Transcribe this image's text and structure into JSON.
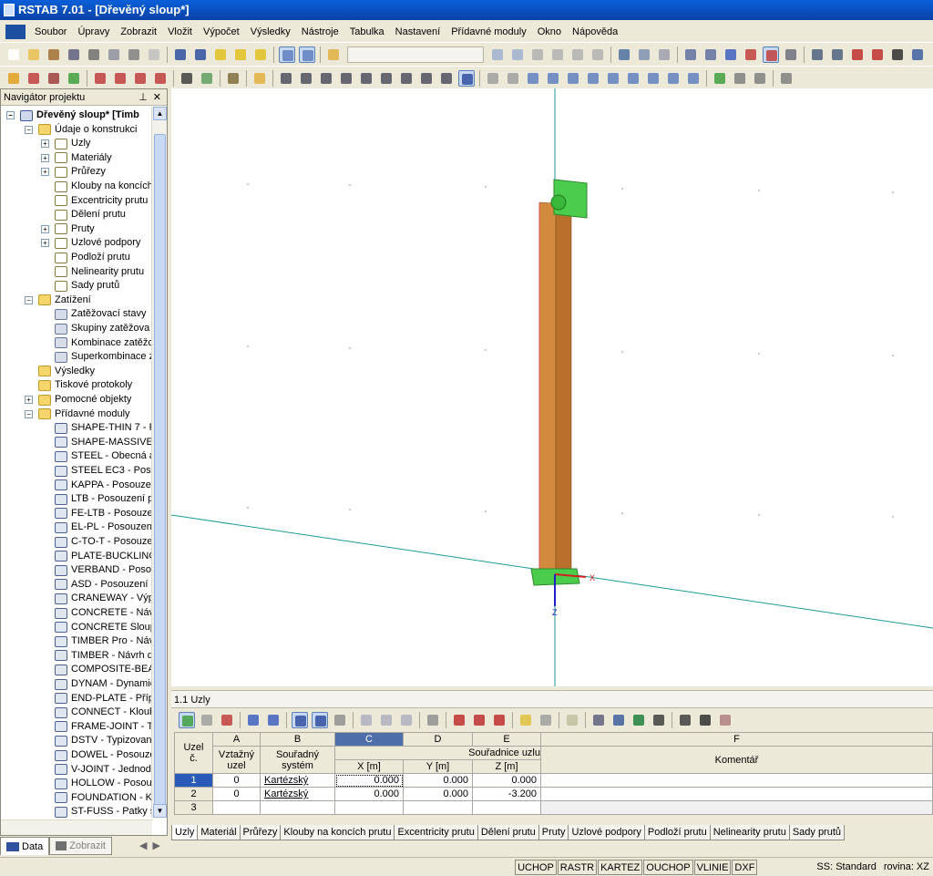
{
  "window": {
    "title": "RSTAB 7.01 - [Dřevěný sloup*]"
  },
  "menu": [
    "Soubor",
    "Úpravy",
    "Zobrazit",
    "Vložit",
    "Výpočet",
    "Výsledky",
    "Nástroje",
    "Tabulka",
    "Nastavení",
    "Přídavné moduly",
    "Okno",
    "Nápověda"
  ],
  "navigator": {
    "title": "Navigátor projektu",
    "tree": [
      {
        "label": "Dřevěný sloup* [Timb",
        "level": 0,
        "exp": "-",
        "icon": "proj",
        "bold": true
      },
      {
        "label": "Údaje o konstrukci",
        "level": 1,
        "exp": "-",
        "icon": "folder"
      },
      {
        "label": "Uzly",
        "level": 2,
        "exp": "+",
        "icon": "node"
      },
      {
        "label": "Materiály",
        "level": 2,
        "exp": "+",
        "icon": "node"
      },
      {
        "label": "Průřezy",
        "level": 2,
        "exp": "+",
        "icon": "node"
      },
      {
        "label": "Klouby na koncích",
        "level": 2,
        "exp": "",
        "icon": "node"
      },
      {
        "label": "Excentricity prutu",
        "level": 2,
        "exp": "",
        "icon": "node"
      },
      {
        "label": "Dělení prutu",
        "level": 2,
        "exp": "",
        "icon": "node"
      },
      {
        "label": "Pruty",
        "level": 2,
        "exp": "+",
        "icon": "node"
      },
      {
        "label": "Uzlové podpory",
        "level": 2,
        "exp": "+",
        "icon": "node"
      },
      {
        "label": "Podloží prutu",
        "level": 2,
        "exp": "",
        "icon": "node"
      },
      {
        "label": "Nelinearity prutu",
        "level": 2,
        "exp": "",
        "icon": "node"
      },
      {
        "label": "Sady prutů",
        "level": 2,
        "exp": "",
        "icon": "node"
      },
      {
        "label": "Zatížení",
        "level": 1,
        "exp": "-",
        "icon": "folder"
      },
      {
        "label": "Zatěžovací stavy",
        "level": 2,
        "exp": "",
        "icon": "load"
      },
      {
        "label": "Skupiny zatěžova",
        "level": 2,
        "exp": "",
        "icon": "load"
      },
      {
        "label": "Kombinace zatěžc",
        "level": 2,
        "exp": "",
        "icon": "load"
      },
      {
        "label": "Superkombinace z",
        "level": 2,
        "exp": "",
        "icon": "load"
      },
      {
        "label": "Výsledky",
        "level": 1,
        "exp": "",
        "icon": "folder"
      },
      {
        "label": "Tiskové protokoly",
        "level": 1,
        "exp": "",
        "icon": "folder"
      },
      {
        "label": "Pomocné objekty",
        "level": 1,
        "exp": "+",
        "icon": "folder"
      },
      {
        "label": "Přídavné moduly",
        "level": 1,
        "exp": "-",
        "icon": "folder"
      },
      {
        "label": "SHAPE-THIN 7 - P",
        "level": 2,
        "exp": "",
        "icon": "mod"
      },
      {
        "label": "SHAPE-MASSIVE -",
        "level": 2,
        "exp": "",
        "icon": "mod"
      },
      {
        "label": "STEEL - Obecná a",
        "level": 2,
        "exp": "",
        "icon": "mod"
      },
      {
        "label": "STEEL EC3 - Posu",
        "level": 2,
        "exp": "",
        "icon": "mod"
      },
      {
        "label": "KAPPA - Posouzer",
        "level": 2,
        "exp": "",
        "icon": "mod"
      },
      {
        "label": "LTB - Posouzení p",
        "level": 2,
        "exp": "",
        "icon": "mod"
      },
      {
        "label": "FE-LTB - Posouze",
        "level": 2,
        "exp": "",
        "icon": "mod"
      },
      {
        "label": "EL-PL - Posouzení",
        "level": 2,
        "exp": "",
        "icon": "mod"
      },
      {
        "label": "C-TO-T - Posouze",
        "level": 2,
        "exp": "",
        "icon": "mod"
      },
      {
        "label": "PLATE-BUCKLING",
        "level": 2,
        "exp": "",
        "icon": "mod"
      },
      {
        "label": "VERBAND - Posou",
        "level": 2,
        "exp": "",
        "icon": "mod"
      },
      {
        "label": "ASD - Posouzení c",
        "level": 2,
        "exp": "",
        "icon": "mod"
      },
      {
        "label": "CRANEWAY - Výp",
        "level": 2,
        "exp": "",
        "icon": "mod"
      },
      {
        "label": "CONCRETE - Návr",
        "level": 2,
        "exp": "",
        "icon": "mod"
      },
      {
        "label": "CONCRETE Sloupy",
        "level": 2,
        "exp": "",
        "icon": "mod"
      },
      {
        "label": "TIMBER Pro - Náv",
        "level": 2,
        "exp": "",
        "icon": "mod"
      },
      {
        "label": "TIMBER - Návrh d",
        "level": 2,
        "exp": "",
        "icon": "mod"
      },
      {
        "label": "COMPOSITE-BEAN",
        "level": 2,
        "exp": "",
        "icon": "mod"
      },
      {
        "label": "DYNAM - Dynamic",
        "level": 2,
        "exp": "",
        "icon": "mod"
      },
      {
        "label": "END-PLATE - Přípc",
        "level": 2,
        "exp": "",
        "icon": "mod"
      },
      {
        "label": "CONNECT - Kloub",
        "level": 2,
        "exp": "",
        "icon": "mod"
      },
      {
        "label": "FRAME-JOINT - T",
        "level": 2,
        "exp": "",
        "icon": "mod"
      },
      {
        "label": "DSTV - Typizovan",
        "level": 2,
        "exp": "",
        "icon": "mod"
      },
      {
        "label": "DOWEL - Posouze",
        "level": 2,
        "exp": "",
        "icon": "mod"
      },
      {
        "label": "V-JOINT - Jednod",
        "level": 2,
        "exp": "",
        "icon": "mod"
      },
      {
        "label": "HOLLOW - Posouz",
        "level": 2,
        "exp": "",
        "icon": "mod"
      },
      {
        "label": "FOUNDATION - K",
        "level": 2,
        "exp": "",
        "icon": "mod"
      },
      {
        "label": "ST-FUSS - Patky s",
        "level": 2,
        "exp": "",
        "icon": "mod"
      }
    ],
    "tabs": [
      "Data",
      "Zobrazit"
    ]
  },
  "viewport": {
    "axis_x": "X",
    "axis_z": "Z"
  },
  "table": {
    "title": "1.1 Uzly",
    "col_letters": [
      "A",
      "B",
      "C",
      "D",
      "E",
      "F"
    ],
    "h_node": [
      "Uzel",
      "č."
    ],
    "h_ref": [
      "Vztažný",
      "uzel"
    ],
    "h_sys": [
      "Souřadný",
      "systém"
    ],
    "h_coords": "Souřadnice uzlu",
    "h_x": "X [m]",
    "h_y": "Y [m]",
    "h_z": "Z [m]",
    "h_comment": "Komentář",
    "rows": [
      {
        "no": "1",
        "ref": "0",
        "sys": "Kartézský",
        "x": "0.000",
        "y": "0.000",
        "z": "0.000"
      },
      {
        "no": "2",
        "ref": "0",
        "sys": "Kartézský",
        "x": "0.000",
        "y": "0.000",
        "z": "-3.200"
      },
      {
        "no": "3",
        "ref": "",
        "sys": "",
        "x": "",
        "y": "",
        "z": ""
      }
    ]
  },
  "sheet_tabs": [
    "Uzly",
    "Materiál",
    "Průřezy",
    "Klouby na koncích prutu",
    "Excentricity prutu",
    "Dělení prutu",
    "Pruty",
    "Uzlové podpory",
    "Podloží prutu",
    "Nelinearity prutu",
    "Sady prutů"
  ],
  "status": {
    "buttons": [
      "UCHOP",
      "RASTR",
      "KARTEZ",
      "OUCHOP",
      "VLINIE",
      "DXF"
    ],
    "ss": "SS: Standard",
    "plane": "rovina: XZ"
  }
}
